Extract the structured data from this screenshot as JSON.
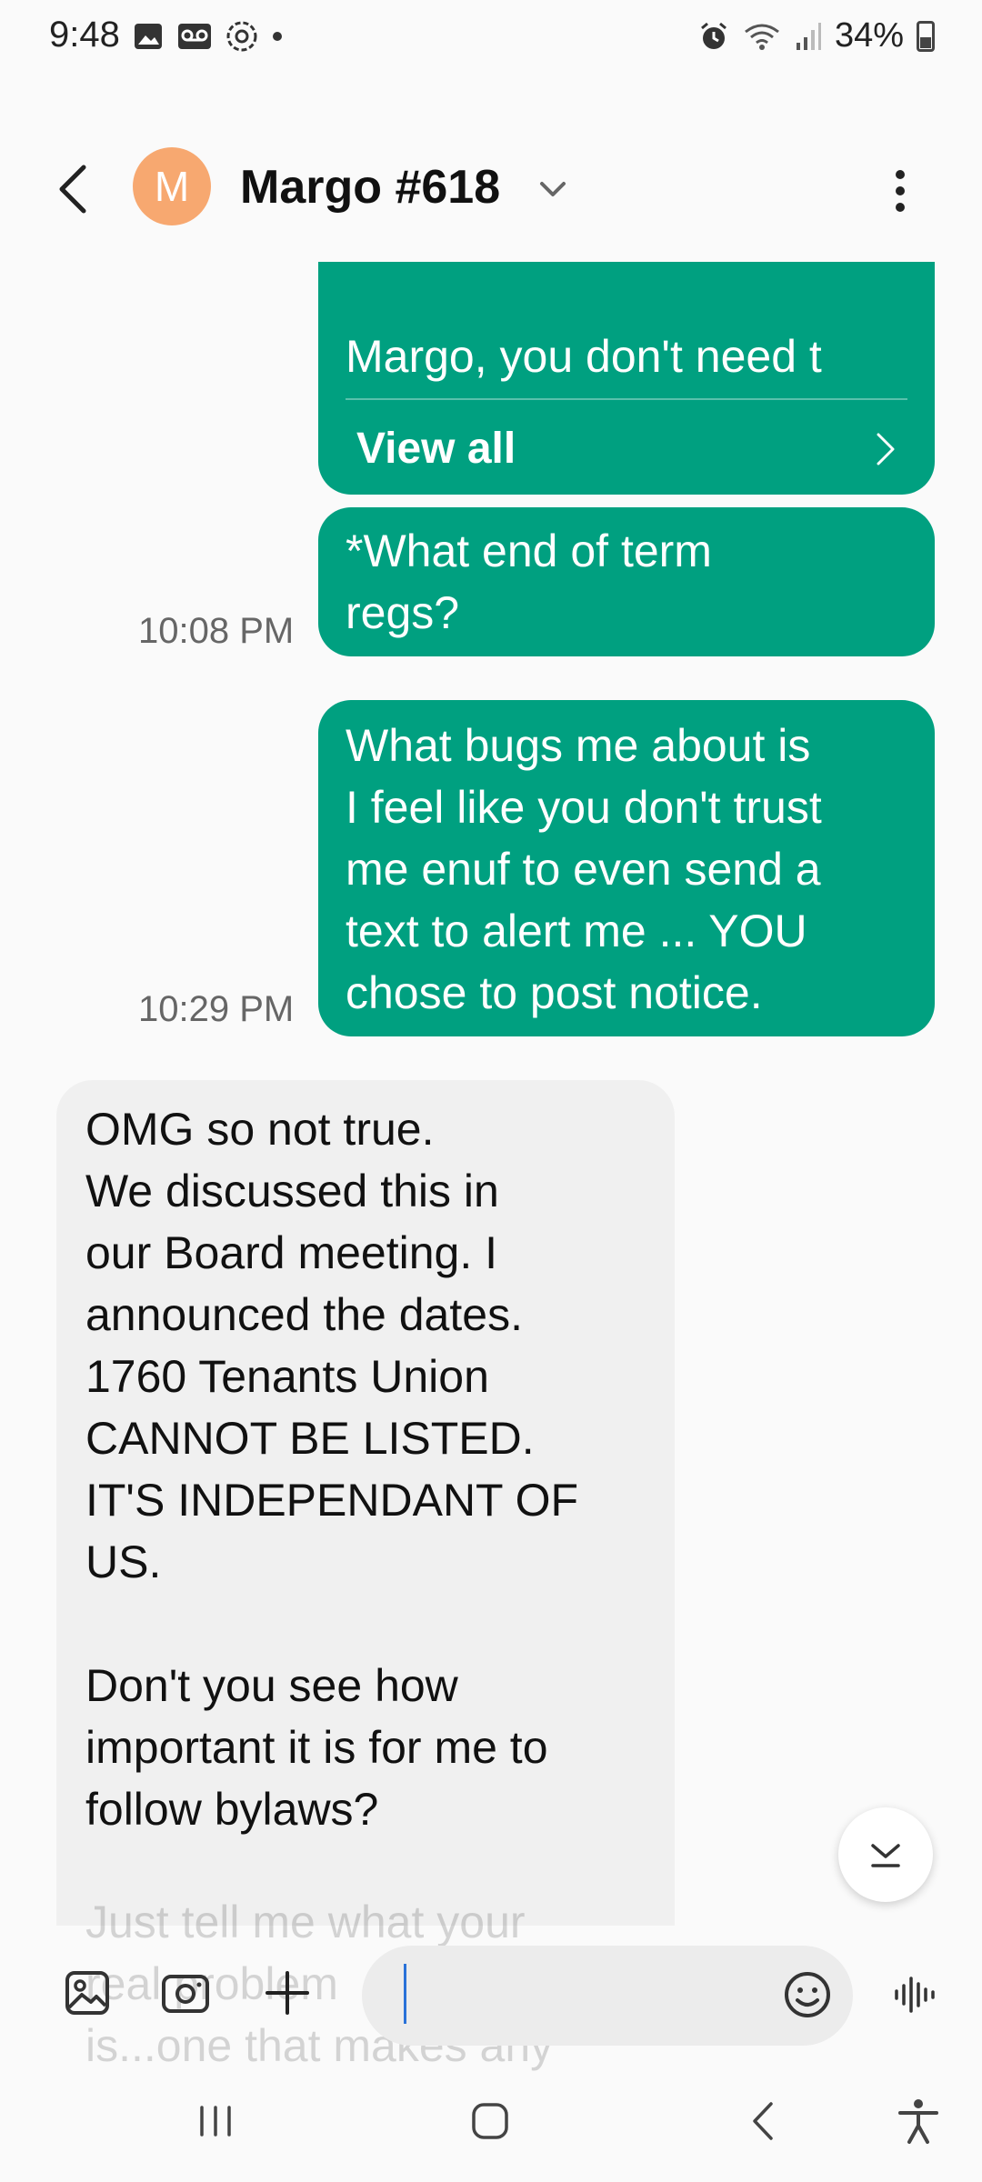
{
  "status_bar": {
    "time": "9:48",
    "battery": "34%"
  },
  "header": {
    "avatar_letter": "M",
    "contact_name": "Margo #618"
  },
  "messages": [
    {
      "direction": "outgoing",
      "text": "Margo, you don't need t",
      "view_all_label": "View all"
    },
    {
      "direction": "outgoing",
      "text": "*What end of term\nregs?",
      "time": "10:08 PM"
    },
    {
      "direction": "outgoing",
      "text": "What bugs me about is\nI feel like you don't trust\nme enuf to even send a\ntext to alert me ... YOU\nchose to post notice.",
      "time": "10:29 PM"
    },
    {
      "direction": "incoming",
      "text": "OMG so not true.\nWe discussed this in\nour Board meeting. I\nannounced the dates.\n1760 Tenants Union\nCANNOT BE LISTED.\nIT'S INDEPENDANT OF\nUS.\n\nDon't you see how\nimportant it is for me to\nfollow bylaws?",
      "faded_text": "Just tell me what your\nreal problem\nis...one that makes any"
    }
  ],
  "composer": {
    "input_value": "",
    "input_placeholder": ""
  },
  "colors": {
    "outgoing_bubble": "#00a080",
    "incoming_bubble": "#f0f0f0",
    "avatar": "#f7a870",
    "caret": "#2a72d8"
  },
  "icons": {
    "status_left": [
      "image-icon",
      "voicemail-icon",
      "aperture-icon",
      "dot-icon"
    ],
    "status_right": [
      "alarm-icon",
      "wifi-icon",
      "signal-icon",
      "battery-icon"
    ],
    "header": [
      "back-arrow-icon",
      "chevron-down-icon",
      "more-vert-icon"
    ],
    "composer": [
      "gallery-icon",
      "camera-icon",
      "plus-icon",
      "emoji-icon",
      "voice-waveform-icon"
    ],
    "nav": [
      "recent-apps-icon",
      "home-icon",
      "back-nav-icon",
      "accessibility-icon"
    ]
  }
}
